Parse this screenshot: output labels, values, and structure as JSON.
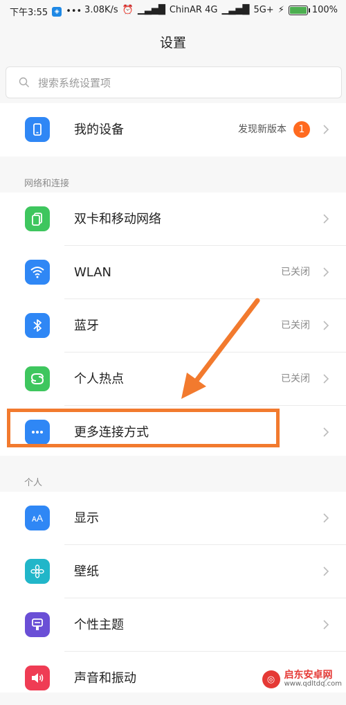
{
  "status_bar": {
    "time": "下午3:55",
    "dots": "•••",
    "speed": "3.08K/s",
    "carrier": "ChinAR 4G",
    "network2": "5G+",
    "battery_pct": "100%",
    "battery_level": 1.0
  },
  "title": "设置",
  "search": {
    "placeholder": "搜索系统设置项"
  },
  "device": {
    "label": "我的设备",
    "status": "发现新版本",
    "badge": "1",
    "icon": "phone-icon"
  },
  "section_network": {
    "header": "网络和连接",
    "items": [
      {
        "label": "双卡和移动网络",
        "status": "",
        "icon": "dual-sim-icon",
        "color": "#3ec65e"
      },
      {
        "label": "WLAN",
        "status": "已关闭",
        "icon": "wifi-icon",
        "color": "#2f87f5"
      },
      {
        "label": "蓝牙",
        "status": "已关闭",
        "icon": "bluetooth-icon",
        "color": "#2f87f5"
      },
      {
        "label": "个人热点",
        "status": "已关闭",
        "icon": "hotspot-icon",
        "color": "#3ec65e"
      },
      {
        "label": "更多连接方式",
        "status": "",
        "icon": "more-icon",
        "color": "#2f87f5"
      }
    ]
  },
  "section_personal": {
    "header": "个人",
    "items": [
      {
        "label": "显示",
        "icon": "display-icon",
        "color": "#2f87f5"
      },
      {
        "label": "壁纸",
        "icon": "wallpaper-icon",
        "color": "#21b6c9"
      },
      {
        "label": "个性主题",
        "icon": "theme-icon",
        "color": "#6a4fd6"
      },
      {
        "label": "声音和振动",
        "icon": "sound-icon",
        "color": "#ef3c54"
      }
    ]
  },
  "watermark": {
    "title": "启东安卓网",
    "url": "www.qdltdq.com"
  },
  "colors": {
    "highlight": "#f27a2e",
    "badge": "#ff6a1f"
  }
}
